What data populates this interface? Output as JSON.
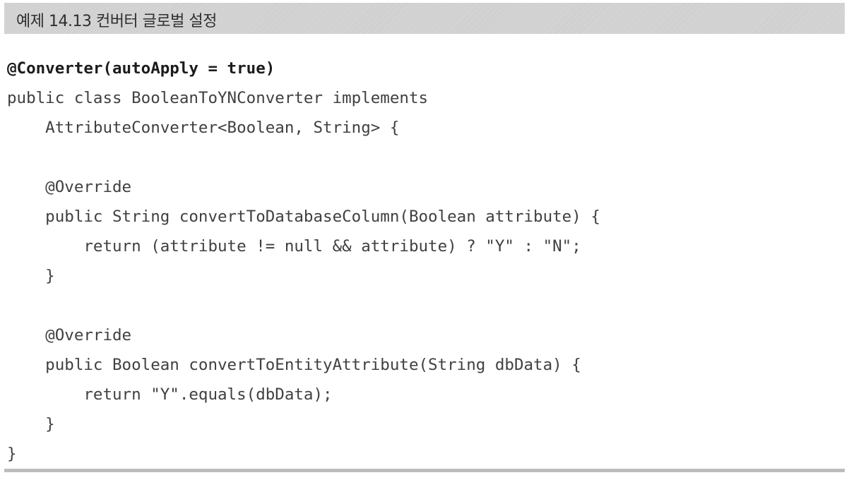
{
  "header": {
    "title": "예제 14.13 컨버터 글로벌 설정"
  },
  "code": {
    "lines": [
      "@Converter(autoApply = true)",
      "public class BooleanToYNConverter implements",
      "    AttributeConverter<Boolean, String> {",
      "",
      "    @Override",
      "    public String convertToDatabaseColumn(Boolean attribute) {",
      "        return (attribute != null && attribute) ? \"Y\" : \"N\";",
      "    }",
      "",
      "    @Override",
      "    public Boolean convertToEntityAttribute(String dbData) {",
      "        return \"Y\".equals(dbData);",
      "    }",
      "}"
    ]
  }
}
